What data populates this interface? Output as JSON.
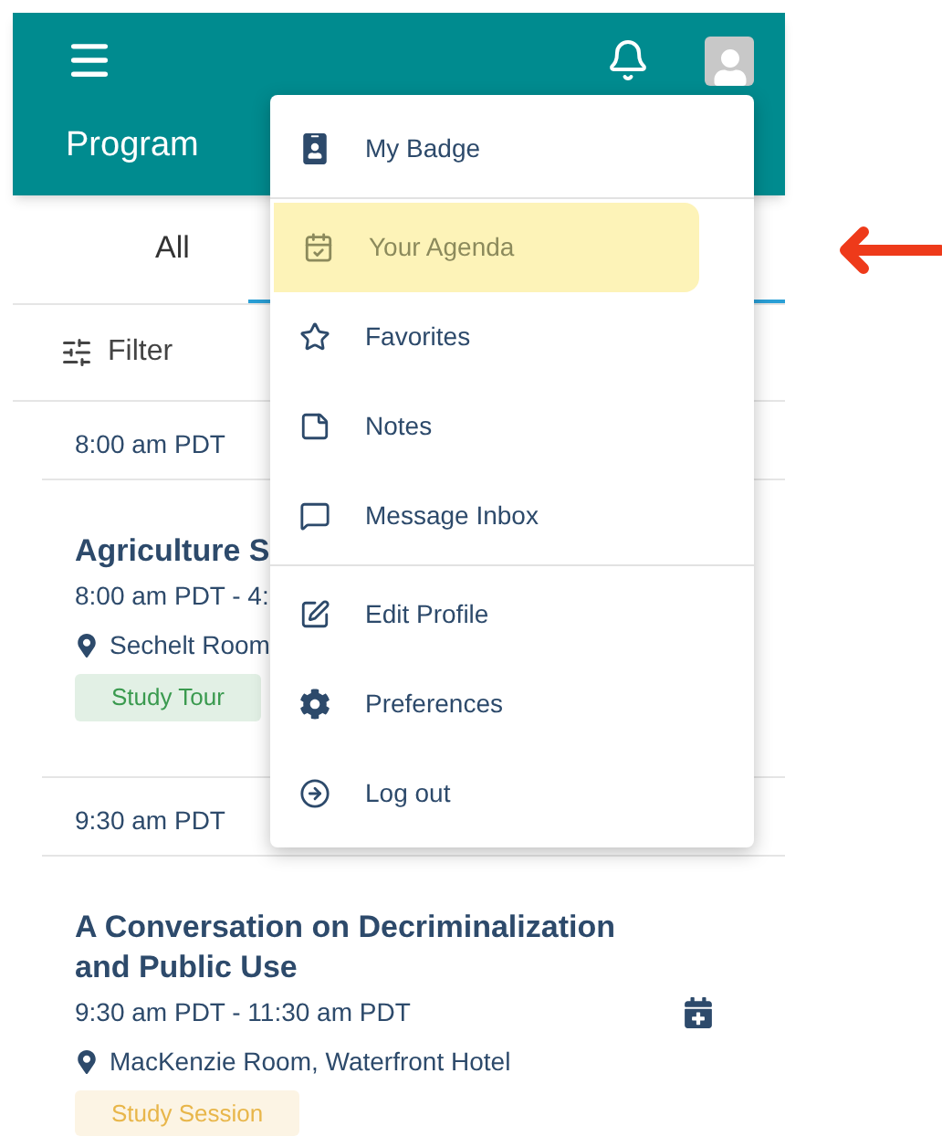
{
  "header": {
    "title": "Program"
  },
  "tabs": [
    {
      "label": "All",
      "selected": false
    },
    {
      "selected": true
    }
  ],
  "filter": {
    "label": "Filter"
  },
  "schedule": [
    {
      "time": "8:00 am PDT",
      "event": {
        "title": [
          "Agriculture S"
        ],
        "time_range": "8:00 am PDT - 4:",
        "location": "Sechelt Room",
        "tag": {
          "label": "Study Tour",
          "color": "#3a9a4f"
        }
      }
    },
    {
      "time": "9:30 am PDT",
      "event": {
        "title": [
          "A Conversation on Decriminalization",
          "and Public Use"
        ],
        "time_range": "9:30 am PDT - 11:30 am PDT",
        "location": "MacKenzie Room, Waterfront Hotel",
        "tag": {
          "label": "Study Session",
          "color": "#e8b64a"
        },
        "add_button": true
      }
    }
  ],
  "user_menu": {
    "groups": [
      [
        {
          "kind": "badge",
          "label": "My Badge",
          "highlighted": false
        }
      ],
      [
        {
          "kind": "agenda",
          "label": "Your Agenda",
          "highlighted": true
        },
        {
          "kind": "favorites",
          "label": "Favorites",
          "highlighted": false
        },
        {
          "kind": "notes",
          "label": "Notes",
          "highlighted": false
        },
        {
          "kind": "inbox",
          "label": "Message Inbox",
          "highlighted": false
        }
      ],
      [
        {
          "kind": "edit",
          "label": "Edit Profile",
          "highlighted": false
        },
        {
          "kind": "preferences",
          "label": "Preferences",
          "highlighted": false
        },
        {
          "kind": "logout",
          "label": "Log out",
          "highlighted": false
        }
      ]
    ]
  }
}
